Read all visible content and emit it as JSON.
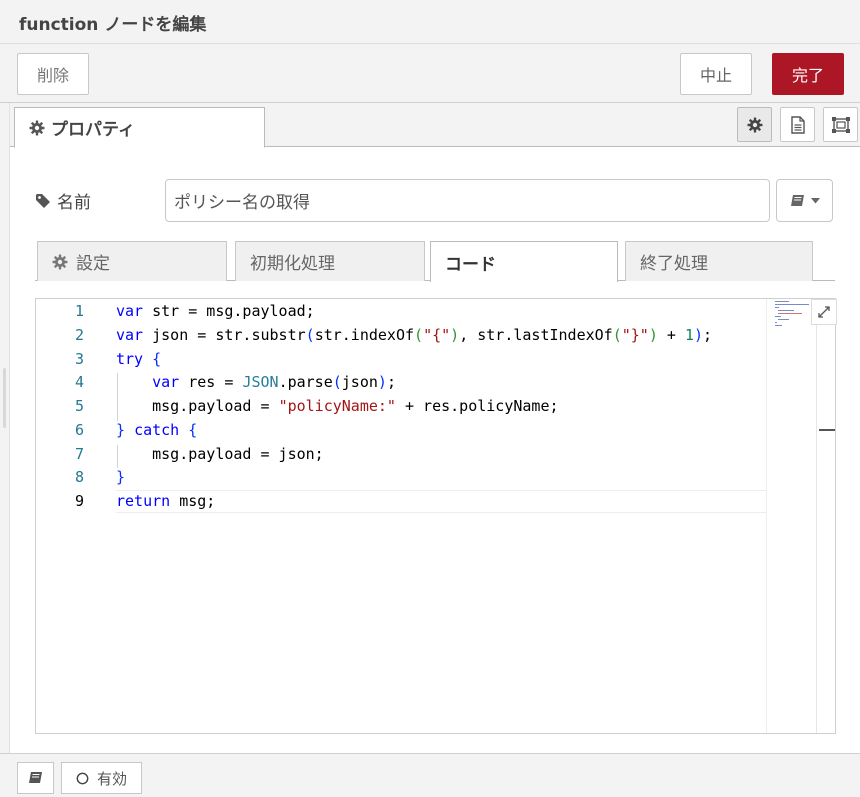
{
  "dialog": {
    "title": "function ノードを編集"
  },
  "actions": {
    "delete_label": "削除",
    "cancel_label": "中止",
    "done_label": "完了"
  },
  "outer_tabs": {
    "properties_label": "プロパティ"
  },
  "name_field": {
    "label": "名前",
    "value": "ポリシー名の取得"
  },
  "inner_tabs": {
    "setup": "設定",
    "init": "初期化処理",
    "code": "コード",
    "close": "終了処理",
    "active": "コード"
  },
  "code": {
    "line_numbers": [
      "1",
      "2",
      "3",
      "4",
      "5",
      "6",
      "7",
      "8",
      "9"
    ],
    "lines": [
      "var str = msg.payload;",
      "var json = str.substr(str.indexOf(\"{\"), str.lastIndexOf(\"}\") + 1);",
      "try {",
      "    var res = JSON.parse(json);",
      "    msg.payload = \"policyName:\" + res.policyName;",
      "} catch {",
      "    msg.payload = json;",
      "}",
      "return msg;"
    ]
  },
  "footer": {
    "enabled_label": "有効"
  },
  "icons": {
    "settings": "gear-icon",
    "description": "file-text-icon",
    "appearance": "object-group-icon",
    "name": "tag-icon",
    "library": "book-icon",
    "expand": "expand-icon",
    "enabled": "circle-outline-icon"
  },
  "colors": {
    "done_button": "#ad1625",
    "keyword": "#0000ff",
    "string": "#a31515",
    "number": "#098658",
    "class": "#267f99",
    "line_number": "#237893"
  }
}
